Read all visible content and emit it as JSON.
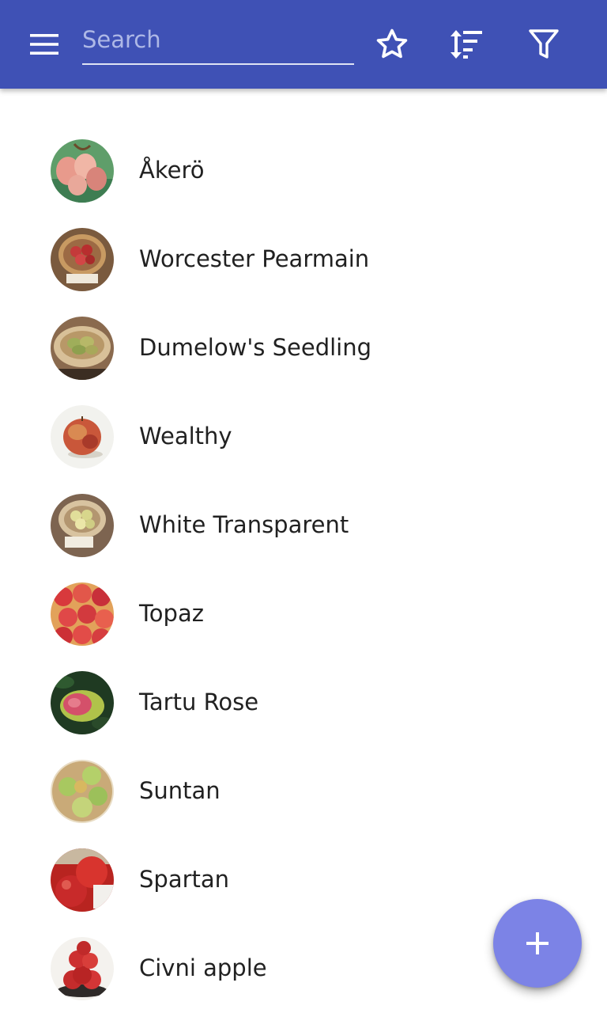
{
  "toolbar": {
    "color": "#3f51b5",
    "menu_icon": "hamburger-menu-icon",
    "search": {
      "placeholder": "Search",
      "value": ""
    },
    "actions": [
      {
        "icon": "star-outline-icon"
      },
      {
        "icon": "sort-icon"
      },
      {
        "icon": "filter-icon"
      }
    ]
  },
  "list": {
    "items": [
      {
        "label": "Åkerö"
      },
      {
        "label": "Worcester Pearmain"
      },
      {
        "label": "Dumelow's Seedling"
      },
      {
        "label": "Wealthy"
      },
      {
        "label": "White Transparent"
      },
      {
        "label": "Topaz"
      },
      {
        "label": "Tartu Rose"
      },
      {
        "label": "Suntan"
      },
      {
        "label": "Spartan"
      },
      {
        "label": "Civni apple"
      }
    ]
  },
  "fab": {
    "icon": "plus-icon",
    "color": "#7c83e6"
  }
}
